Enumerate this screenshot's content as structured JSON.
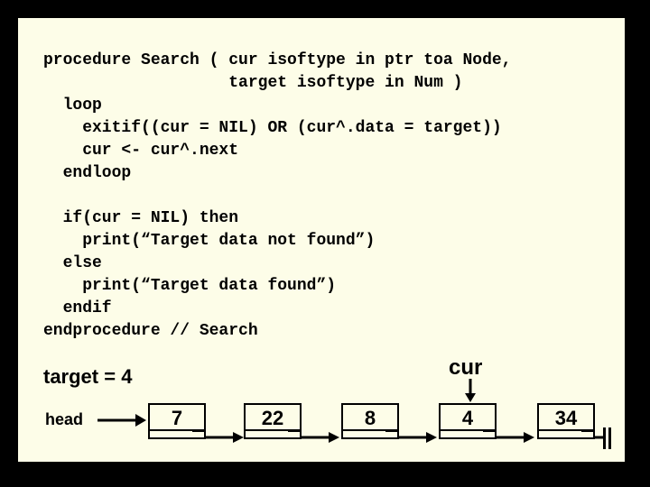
{
  "code": {
    "l1": "procedure Search ( cur isoftype in ptr toa Node,",
    "l2": "                   target isoftype in Num )",
    "l3": "  loop",
    "l4": "    exitif((cur = NIL) OR (cur^.data = target))",
    "l5": "    cur <- cur^.next",
    "l6": "  endloop",
    "l7": "",
    "l8": "  if(cur = NIL) then",
    "l9": "    print(“Target data not found”)",
    "l10": "  else",
    "l11": "    print(“Target data found”)",
    "l12": "  endif",
    "l13": "endprocedure // Search"
  },
  "labels": {
    "target": "target = 4",
    "cur": "cur",
    "head": "head"
  },
  "nodes": {
    "n0": "7",
    "n1": "22",
    "n2": "8",
    "n3": "4",
    "n4": "34"
  },
  "chart_data": {
    "type": "table",
    "title": "Linked list search trace",
    "target": 4,
    "cur_index": 3,
    "list": [
      7,
      22,
      8,
      4,
      34
    ]
  }
}
